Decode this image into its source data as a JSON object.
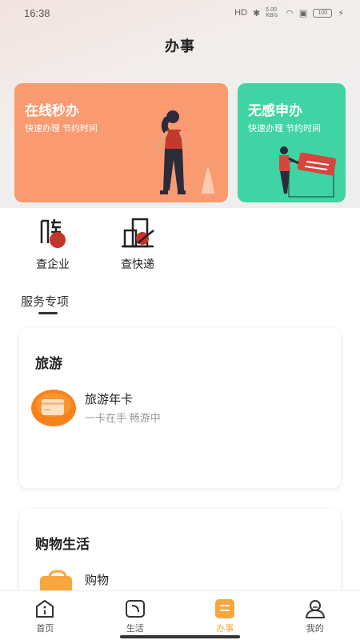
{
  "status_bar": {
    "time": "16:38",
    "net_speed": "5.00\nKB/s",
    "battery": "100"
  },
  "header": {
    "title": "办事"
  },
  "banners": [
    {
      "title": "在线秒办",
      "subtitle": "快速办理 节约时间",
      "color": "#fa9a70"
    },
    {
      "title": "无感申办",
      "subtitle": "快速办理 节约时间",
      "color": "#40d4a5"
    }
  ],
  "quick_actions": [
    {
      "label": "查企业",
      "icon": "company-stamp-icon"
    },
    {
      "label": "查快递",
      "icon": "package-icon"
    }
  ],
  "section": {
    "title": "服务专项"
  },
  "panels": [
    {
      "title": "旅游",
      "items": [
        {
          "name": "旅游年卡",
          "desc": "一卡在手 畅游中",
          "icon": "card-icon"
        }
      ]
    },
    {
      "title": "购物生活",
      "items": [
        {
          "name": "购物",
          "desc": "",
          "icon": "shopping-bag-icon"
        }
      ]
    }
  ],
  "tab_bar": {
    "items": [
      {
        "label": "首页",
        "icon": "home-icon"
      },
      {
        "label": "生活",
        "icon": "life-icon"
      },
      {
        "label": "办事",
        "icon": "service-icon"
      },
      {
        "label": "我的",
        "icon": "profile-icon"
      }
    ],
    "active_index": 2,
    "active_color": "#f7a640"
  }
}
